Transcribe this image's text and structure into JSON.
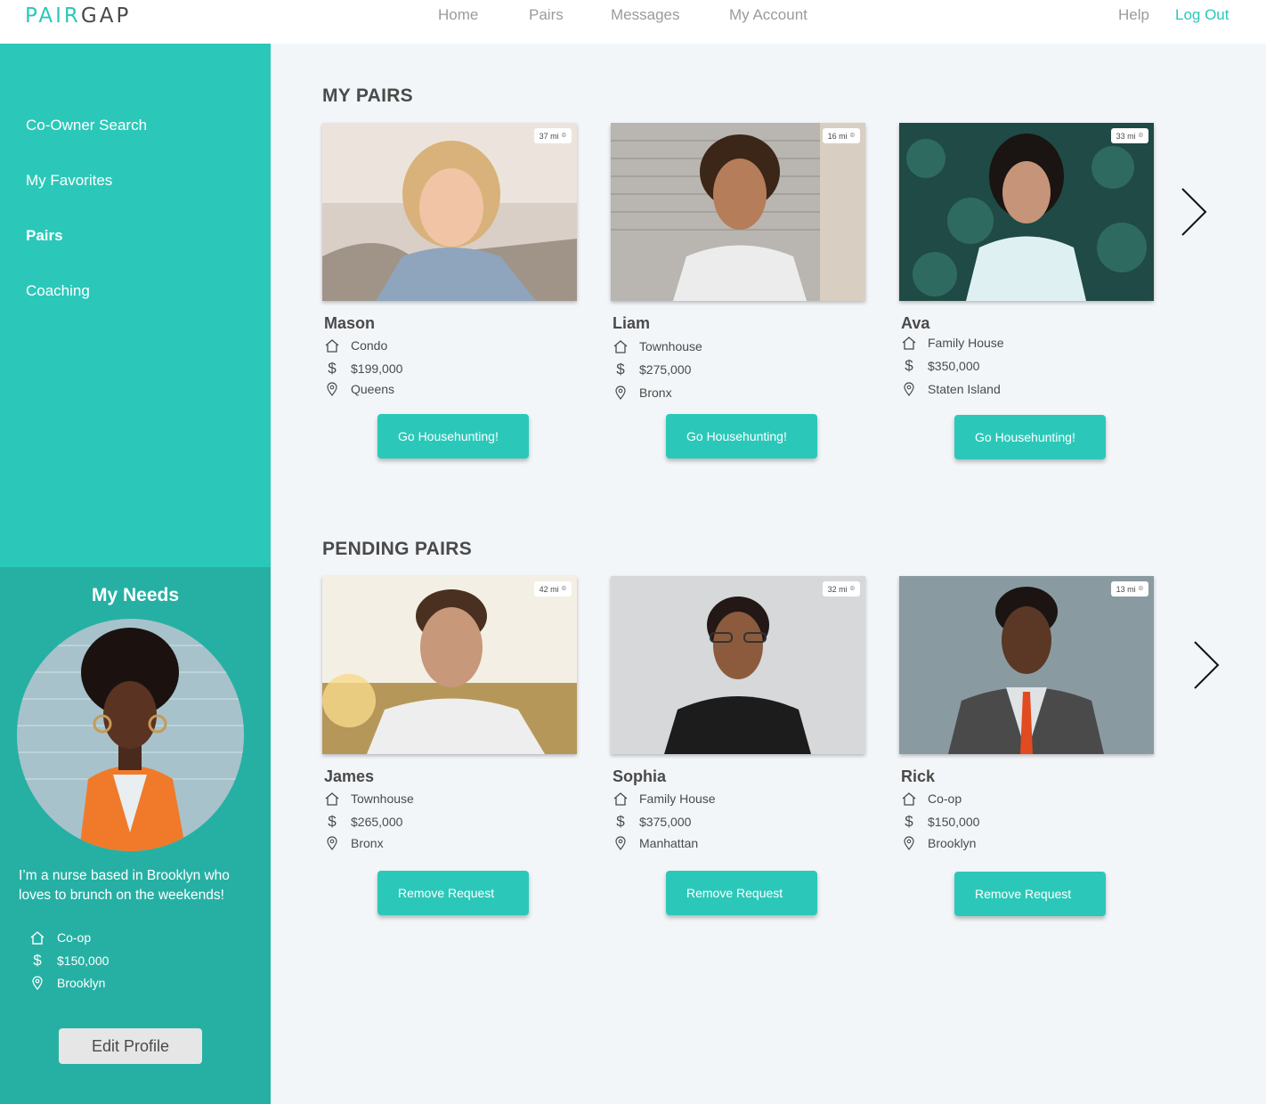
{
  "brand": {
    "part1": "PAIR",
    "part2": "GAP",
    "accent": "#2bc8b9"
  },
  "nav": {
    "home": "Home",
    "pairs": "Pairs",
    "messages": "Messages",
    "account": "My Account",
    "help": "Help",
    "logout": "Log Out"
  },
  "sidebar": {
    "items": [
      {
        "label": "Co-Owner Search"
      },
      {
        "label": "My Favorites"
      },
      {
        "label": "Pairs",
        "active": true
      },
      {
        "label": "Coaching"
      }
    ]
  },
  "needs": {
    "title": "My Needs",
    "bio": "I’m a nurse based in Brooklyn who loves to brunch on the weekends!",
    "type": "Co-op",
    "price": "$150,000",
    "location": "Brooklyn",
    "edit_label": "Edit Profile"
  },
  "my_pairs": {
    "title": "MY PAIRS",
    "action": "Go Househunting!",
    "cards": [
      {
        "name": "Mason",
        "distance": "37 mi",
        "type": "Condo",
        "price": "$199,000",
        "location": "Queens"
      },
      {
        "name": "Liam",
        "distance": "16 mi",
        "type": "Townhouse",
        "price": "$275,000",
        "location": "Bronx"
      },
      {
        "name": "Ava",
        "distance": "33 mi",
        "type": "Family House",
        "price": "$350,000",
        "location": "Staten Island"
      }
    ]
  },
  "pending_pairs": {
    "title": "PENDING PAIRS",
    "action": "Remove Request",
    "cards": [
      {
        "name": "James",
        "distance": "42 mi",
        "type": "Townhouse",
        "price": "$265,000",
        "location": "Bronx"
      },
      {
        "name": "Sophia",
        "distance": "32 mi",
        "type": "Family House",
        "price": "$375,000",
        "location": "Manhattan"
      },
      {
        "name": "Rick",
        "distance": "13 mi",
        "type": "Co-op",
        "price": "$150,000",
        "location": "Brooklyn"
      }
    ]
  },
  "icons": {
    "home": "house-icon",
    "price": "dollar-icon",
    "location": "location-pin-icon",
    "next": "chevron-right-icon"
  }
}
